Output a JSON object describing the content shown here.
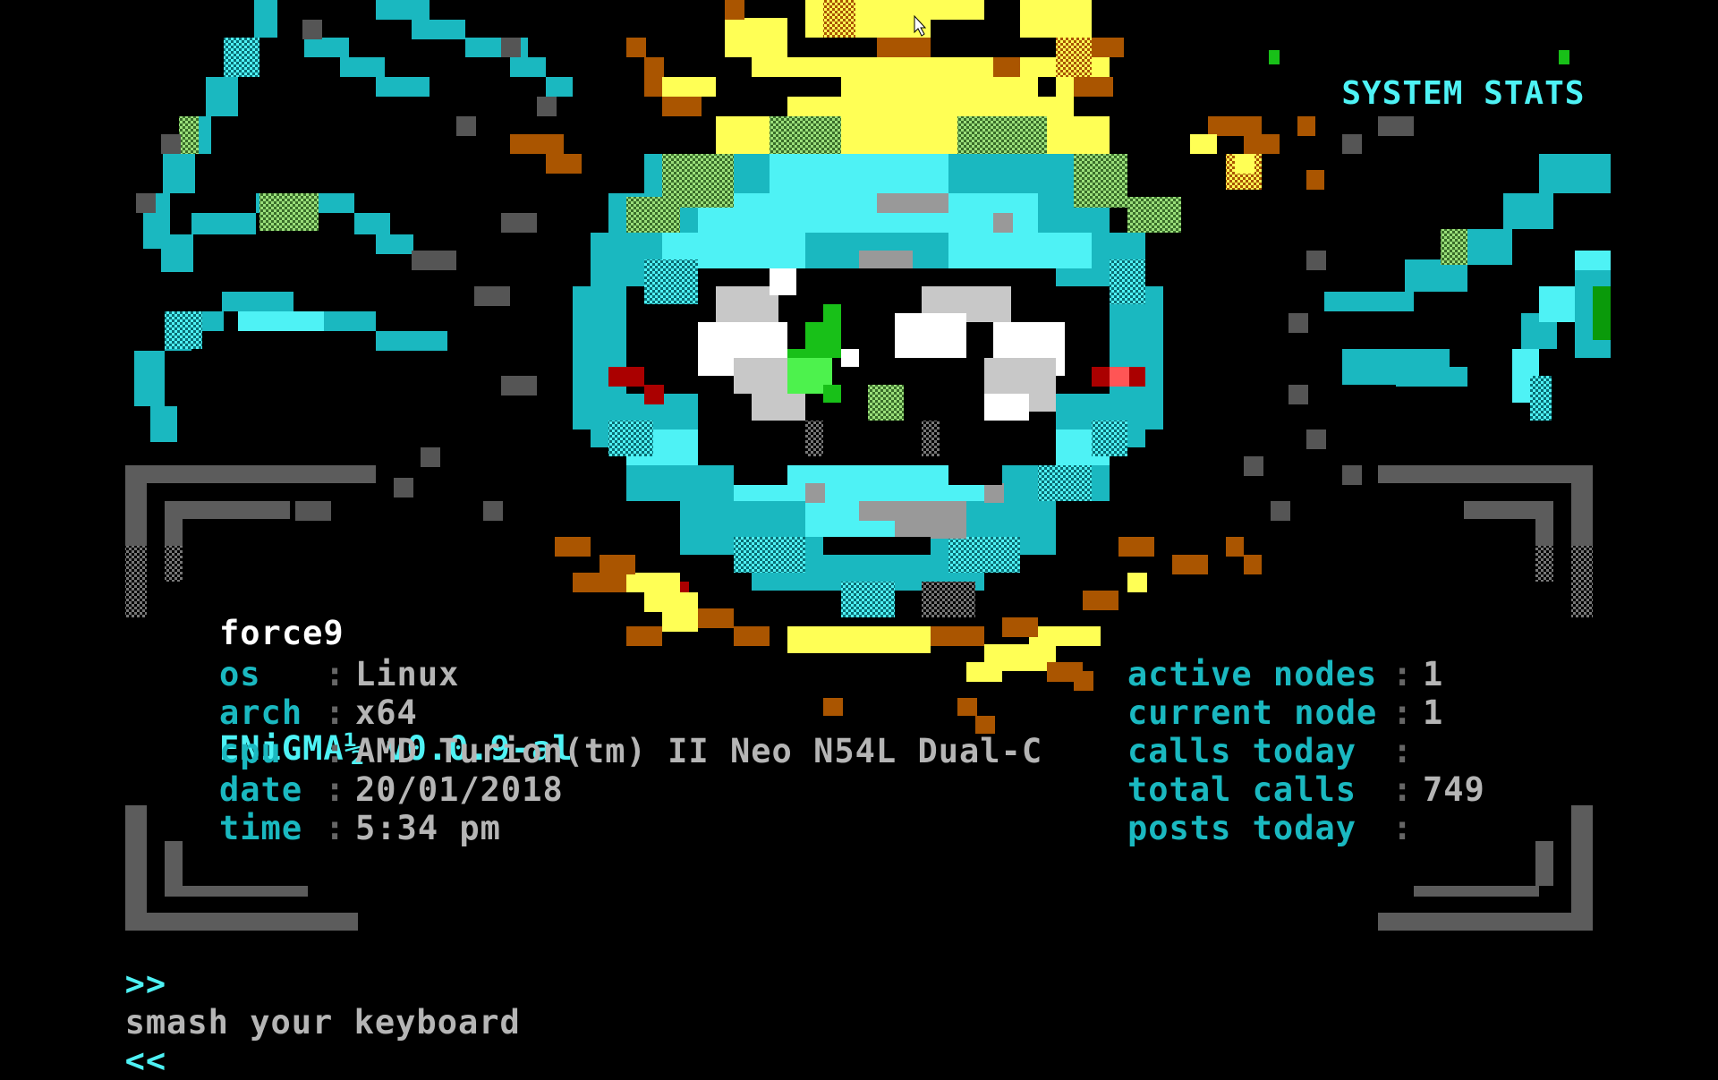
{
  "header": {
    "stats_title": "SYSTEM STATS",
    "stats_bullet_left": "■",
    "stats_bullet_right": "■"
  },
  "board": {
    "name": "force9",
    "software": "ENiGMA½ v0.0.9-al"
  },
  "system": {
    "rows": [
      {
        "label": "os",
        "value": "Linux"
      },
      {
        "label": "arch",
        "value": "x64"
      },
      {
        "label": "cpu",
        "value": "AMD Turion(tm) II Neo N54L Dual-C"
      },
      {
        "label": "date",
        "value": "20/01/2018"
      },
      {
        "label": "time",
        "value": "5:34 pm"
      }
    ]
  },
  "nodes": {
    "rows": [
      {
        "label": "active nodes",
        "value": "1"
      },
      {
        "label": "current node",
        "value": "1"
      },
      {
        "label": "calls today",
        "value": ""
      },
      {
        "label": "total calls",
        "value": "749"
      },
      {
        "label": "posts today",
        "value": ""
      }
    ]
  },
  "separator": ":",
  "prompt": {
    "left": ">>",
    "text": "smash your keyboard",
    "right": "<<"
  },
  "icons": {
    "cursor": "mouse-pointer-icon",
    "art": "ansi-eye-artwork"
  },
  "colors": {
    "background": "#000000",
    "cyan": "#1ab8c0",
    "bright_cyan": "#4ef2f5",
    "grey": "#b5b5b5",
    "yellow": "#ffff55",
    "orange": "#aa5500",
    "green": "#18c018"
  }
}
